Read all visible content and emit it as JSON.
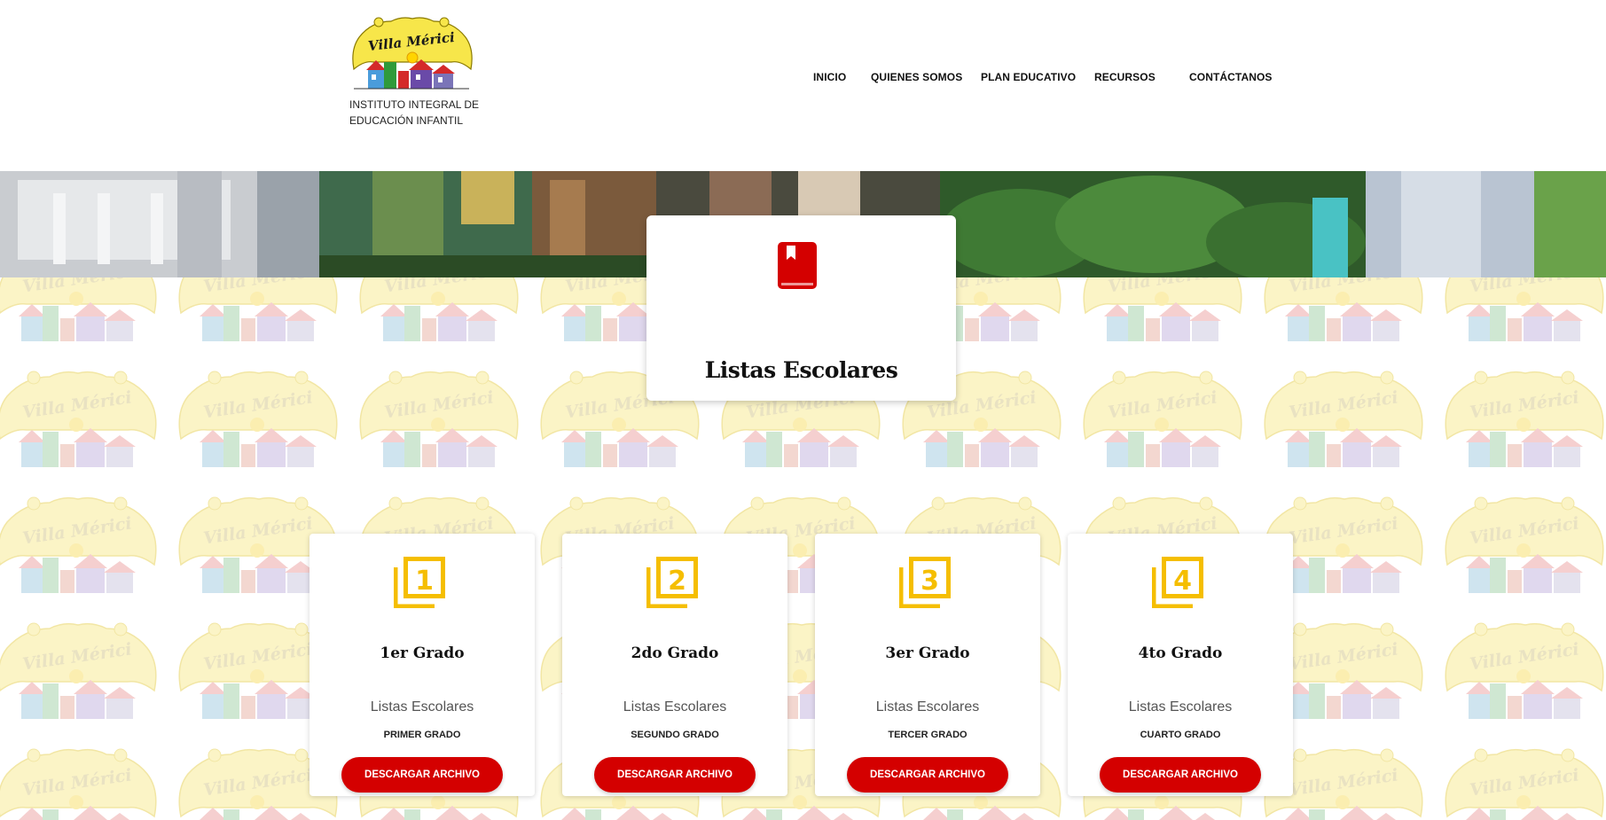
{
  "header": {
    "logo_text": "Villa Mérici",
    "tagline": "INSTITUTO INTEGRAL DE EDUCACIÓN INFANTIL",
    "nav": [
      "INICIO",
      "QUIENES SOMOS",
      "PLAN EDUCATIVO",
      "RECURSOS",
      "CONTÁCTANOS"
    ]
  },
  "hero": {
    "image": "school-courtyard-photo"
  },
  "title_card": {
    "icon": "book-icon",
    "title": "Listas Escolares"
  },
  "grades": [
    {
      "icon_number": "1",
      "title": "1er Grado",
      "subtitle": "Listas Escolares",
      "grade_label": "PRIMER GRADO",
      "button": "DESCARGAR ARCHIVO"
    },
    {
      "icon_number": "2",
      "title": "2do Grado",
      "subtitle": "Listas Escolares",
      "grade_label": "SEGUNDO GRADO",
      "button": "DESCARGAR ARCHIVO"
    },
    {
      "icon_number": "3",
      "title": "3er Grado",
      "subtitle": "Listas Escolares",
      "grade_label": "TERCER GRADO",
      "button": "DESCARGAR ARCHIVO"
    },
    {
      "icon_number": "4",
      "title": "4to Grado",
      "subtitle": "Listas Escolares",
      "grade_label": "CUARTO GRADO",
      "button": "DESCARGAR ARCHIVO"
    }
  ],
  "colors": {
    "accent_red": "#d40000",
    "icon_yellow": "#f5be00",
    "logo_yellow": "#f7e64a"
  }
}
